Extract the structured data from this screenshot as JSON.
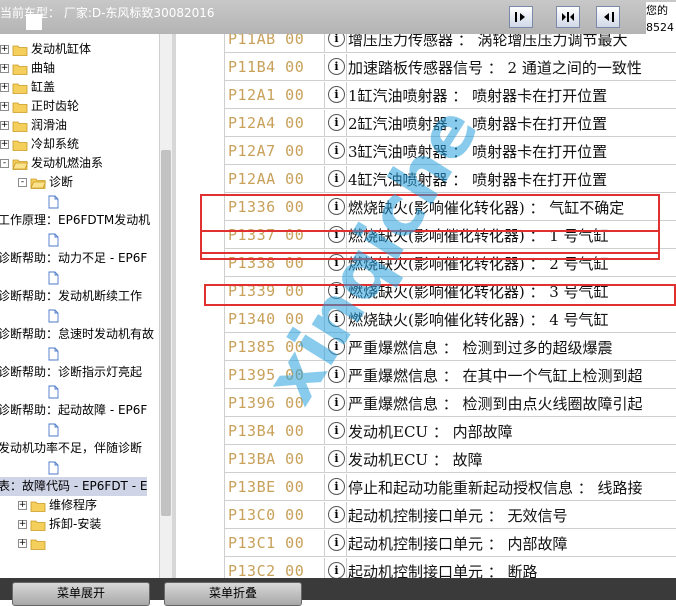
{
  "header": {
    "vehicle": "当前车型： 厂家:D-东风标致30082016",
    "corner_line1": "您的",
    "corner_line2": "8524"
  },
  "tree": [
    {
      "label": "发动机缸体",
      "indent": 0,
      "type": "folder",
      "expander": "+"
    },
    {
      "label": "曲轴",
      "indent": 0,
      "type": "folder",
      "expander": "+"
    },
    {
      "label": "缸盖",
      "indent": 0,
      "type": "folder",
      "expander": "+"
    },
    {
      "label": "正时齿轮",
      "indent": 0,
      "type": "folder",
      "expander": "+"
    },
    {
      "label": "润滑油",
      "indent": 0,
      "type": "folder",
      "expander": "+"
    },
    {
      "label": "冷却系统",
      "indent": 0,
      "type": "folder",
      "expander": "+"
    },
    {
      "label": "发动机燃油系",
      "indent": 0,
      "type": "folder-open",
      "expander": "-"
    },
    {
      "label": "诊断",
      "indent": 1,
      "type": "folder-open",
      "expander": "-"
    },
    {
      "label": "",
      "indent": 2,
      "type": "doc",
      "expander": ""
    },
    {
      "label": "工作原理：EP6FDTM发动机",
      "indent": -1,
      "type": "text",
      "expander": ""
    },
    {
      "label": "",
      "indent": 2,
      "type": "doc",
      "expander": ""
    },
    {
      "label": "诊断帮助：动力不足 - EP6F",
      "indent": -1,
      "type": "text",
      "expander": ""
    },
    {
      "label": "",
      "indent": 2,
      "type": "doc",
      "expander": ""
    },
    {
      "label": "诊断帮助：发动机断续工作",
      "indent": -1,
      "type": "text",
      "expander": ""
    },
    {
      "label": "",
      "indent": 2,
      "type": "doc",
      "expander": ""
    },
    {
      "label": "诊断帮助：怠速时发动机有故",
      "indent": -1,
      "type": "text",
      "expander": ""
    },
    {
      "label": "",
      "indent": 2,
      "type": "doc",
      "expander": ""
    },
    {
      "label": "诊断帮助：诊断指示灯亮起",
      "indent": -1,
      "type": "text",
      "expander": ""
    },
    {
      "label": "",
      "indent": 2,
      "type": "doc",
      "expander": ""
    },
    {
      "label": "诊断帮助：起动故障 - EP6F",
      "indent": -1,
      "type": "text",
      "expander": ""
    },
    {
      "label": "",
      "indent": 2,
      "type": "doc",
      "expander": ""
    },
    {
      "label": "发动机功率不足，伴随诊断",
      "indent": -1,
      "type": "text",
      "expander": ""
    },
    {
      "label": "",
      "indent": 2,
      "type": "doc",
      "expander": ""
    },
    {
      "label": "表：故障代码 - EP6FDT - E",
      "indent": -1,
      "type": "text",
      "expander": "",
      "selected": true
    },
    {
      "label": "维修程序",
      "indent": 1,
      "type": "folder",
      "expander": "+"
    },
    {
      "label": "拆卸-安装",
      "indent": 1,
      "type": "folder",
      "expander": "+"
    },
    {
      "label": "",
      "indent": 1,
      "type": "folder",
      "expander": "+"
    }
  ],
  "rows": [
    {
      "code": "P11AB 00",
      "desc": "增压压力传感器 ： 涡轮增压压力调节最大"
    },
    {
      "code": "P11B4 00",
      "desc": "加速踏板传感器信号 ： 2 通道之间的一致性"
    },
    {
      "code": "P12A1 00",
      "desc": "1缸汽油喷射器 ： 喷射器卡在打开位置"
    },
    {
      "code": "P12A4 00",
      "desc": "2缸汽油喷射器 ： 喷射器卡在打开位置"
    },
    {
      "code": "P12A7 00",
      "desc": "3缸汽油喷射器 ： 喷射器卡在打开位置"
    },
    {
      "code": "P12AA 00",
      "desc": "4缸汽油喷射器 ： 喷射器卡在打开位置"
    },
    {
      "code": "P1336 00",
      "desc": "燃烧缺火(影响催化转化器) ： 气缸不确定"
    },
    {
      "code": "P1337 00",
      "desc": "燃烧缺火(影响催化转化器) ： 1 号气缸"
    },
    {
      "code": "P1338 00",
      "desc": "燃烧缺火(影响催化转化器) ： 2 号气缸"
    },
    {
      "code": "P1339 00",
      "desc": "燃烧缺火(影响催化转化器) ： 3 号气缸"
    },
    {
      "code": "P1340 00",
      "desc": "燃烧缺火(影响催化转化器) ： 4 号气缸"
    },
    {
      "code": "P1385 00",
      "desc": "严重爆燃信息 ： 检测到过多的超级爆震"
    },
    {
      "code": "P1395 00",
      "desc": "严重爆燃信息 ： 在其中一个气缸上检测到超"
    },
    {
      "code": "P1396 00",
      "desc": "严重爆燃信息 ： 检测到由点火线圈故障引起"
    },
    {
      "code": "P13B4 00",
      "desc": "发动机ECU ： 内部故障"
    },
    {
      "code": "P13BA 00",
      "desc": "发动机ECU ： 故障"
    },
    {
      "code": "P13BE 00",
      "desc": "停止和起动功能重新起动授权信息 ： 线路接"
    },
    {
      "code": "P13C0 00",
      "desc": "起动机控制接口单元 ： 无效信号"
    },
    {
      "code": "P13C1 00",
      "desc": "起动机控制接口单元 ： 内部故障"
    },
    {
      "code": "P13C2 00",
      "desc": "起动机控制接口单元 ： 断路"
    }
  ],
  "icons": {
    "info": "i"
  },
  "watermark": "xinqiche",
  "bottom": {
    "expand_label": "菜单展开",
    "collapse_label": "菜单折叠"
  },
  "colors": {
    "code": "#c8a15a",
    "highlight": "#e03030",
    "watermark": "#28a0dc"
  }
}
